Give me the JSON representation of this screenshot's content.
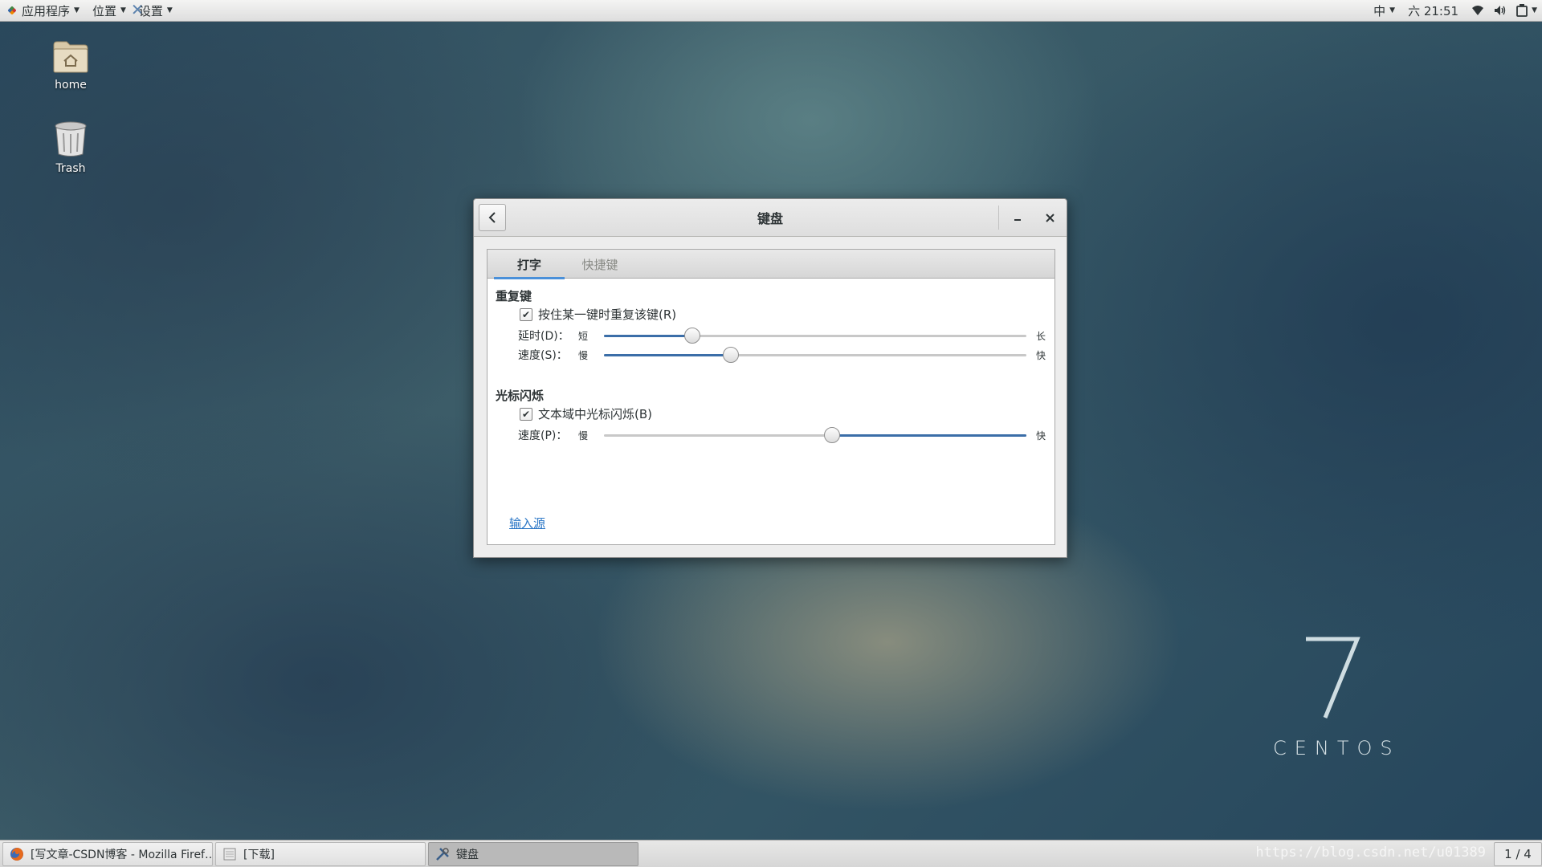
{
  "topbar": {
    "applications": "应用程序",
    "places": "位置",
    "settings": "设置",
    "input_method": "中",
    "clock": "六 21:51"
  },
  "desktop": {
    "icons": [
      {
        "label": "home",
        "icon": "folder-home-icon"
      },
      {
        "label": "Trash",
        "icon": "trash-icon"
      }
    ],
    "watermark_number": "7",
    "watermark_text": "CENTOS"
  },
  "window": {
    "title": "键盘",
    "tabs": [
      {
        "label": "打字",
        "active": true
      },
      {
        "label": "快捷键",
        "active": false
      }
    ],
    "repeat_section": {
      "title": "重复键",
      "checkbox_label": "按住某一键时重复该键(R)",
      "checked": true,
      "delay": {
        "label": "延时(D)：",
        "min": "短",
        "max": "长",
        "value": 0.21
      },
      "speed": {
        "label": "速度(S)：",
        "min": "慢",
        "max": "快",
        "value": 0.3
      }
    },
    "cursor_section": {
      "title": "光标闪烁",
      "checkbox_label": "文本域中光标闪烁(B)",
      "checked": true,
      "speed": {
        "label": "速度(P)：",
        "min": "慢",
        "max": "快",
        "value": 0.54
      }
    },
    "input_sources_link": "输入源"
  },
  "taskbar": {
    "tasks": [
      {
        "label": "[写文章-CSDN博客 - Mozilla Firef…",
        "icon": "firefox-icon",
        "active": false
      },
      {
        "label": "[下载]",
        "icon": "file-manager-icon",
        "active": false
      },
      {
        "label": "键盘",
        "icon": "settings-tools-icon",
        "active": true
      }
    ],
    "workspace": "1 / 4",
    "watermark": "https://blog.csdn.net/u01389"
  },
  "colors": {
    "accent": "#3b6ea8",
    "link": "#2a76c6"
  }
}
